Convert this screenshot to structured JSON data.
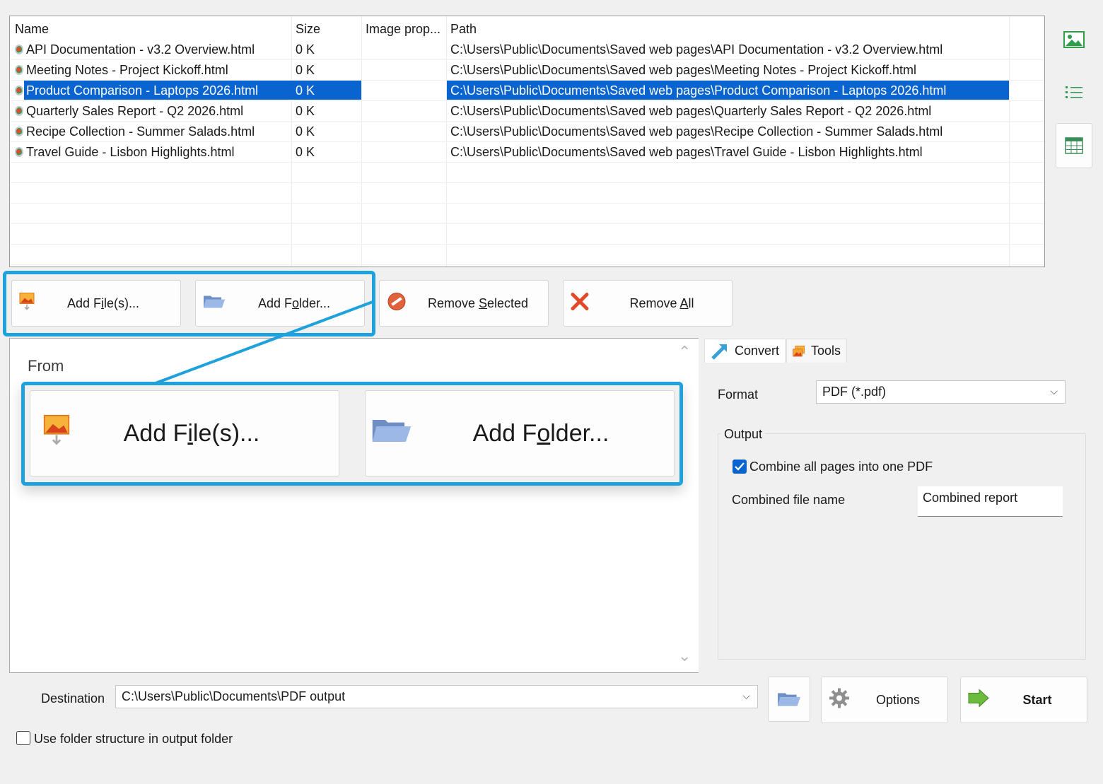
{
  "file_table": {
    "columns": [
      "Name",
      "Size",
      "Image prop...",
      "Path"
    ],
    "rows": [
      {
        "name": "API Documentation - v3.2 Overview.html",
        "size": "0 K",
        "image_props": "",
        "path": "C:\\Users\\Public\\Documents\\Saved web pages\\API Documentation - v3.2 Overview.html",
        "selected": false
      },
      {
        "name": "Meeting Notes - Project Kickoff.html",
        "size": "0 K",
        "image_props": "",
        "path": "C:\\Users\\Public\\Documents\\Saved web pages\\Meeting Notes - Project Kickoff.html",
        "selected": false
      },
      {
        "name": "Product Comparison - Laptops 2026.html",
        "size": "0 K",
        "image_props": "",
        "path": "C:\\Users\\Public\\Documents\\Saved web pages\\Product Comparison - Laptops 2026.html",
        "selected": true
      },
      {
        "name": "Quarterly Sales Report - Q2 2026.html",
        "size": "0 K",
        "image_props": "",
        "path": "C:\\Users\\Public\\Documents\\Saved web pages\\Quarterly Sales Report - Q2 2026.html",
        "selected": false
      },
      {
        "name": "Recipe Collection - Summer Salads.html",
        "size": "0 K",
        "image_props": "",
        "path": "C:\\Users\\Public\\Documents\\Saved web pages\\Recipe Collection - Summer Salads.html",
        "selected": false
      },
      {
        "name": "Travel Guide - Lisbon Highlights.html",
        "size": "0 K",
        "image_props": "",
        "path": "C:\\Users\\Public\\Documents\\Saved web pages\\Travel Guide - Lisbon Highlights.html",
        "selected": false
      }
    ]
  },
  "toolbar": {
    "add_files": {
      "pre": "Add F",
      "mn": "i",
      "post": "le(s)..."
    },
    "add_folder": {
      "pre": "Add F",
      "mn": "o",
      "post": "lder..."
    },
    "remove_selected": {
      "pre": "Remove ",
      "mn": "S",
      "post": "elected"
    },
    "remove_all": {
      "pre": "Remove ",
      "mn": "A",
      "post": "ll"
    }
  },
  "from_pane": {
    "title": "From",
    "zoom_add_files": {
      "pre": "Add F",
      "mn": "i",
      "post": "le(s)..."
    },
    "zoom_add_folder": {
      "pre": "Add F",
      "mn": "o",
      "post": "lder..."
    }
  },
  "tabs": [
    {
      "label": "Convert",
      "icon": "convert-arrow-icon",
      "active": true
    },
    {
      "label": "Tools",
      "icon": "tools-images-icon",
      "active": false
    }
  ],
  "convert": {
    "format_label": "Format",
    "format_value": "PDF (*.pdf)",
    "output_group": "Output",
    "combine_label": "Combine all pages into one PDF",
    "combine_checked": true,
    "combined_name_label": "Combined file name",
    "combined_name_value": "Combined report"
  },
  "bottom": {
    "destination_label": "Destination",
    "destination_value": "C:\\Users\\Public\\Documents\\PDF output",
    "options_label": "Options",
    "start_label": "Start",
    "folder_structure_label": "Use folder structure in output folder",
    "folder_structure_checked": false
  },
  "side_views": [
    "thumbnail-view-icon",
    "list-view-icon",
    "table-view-icon"
  ],
  "colors": {
    "selection": "#0a64cf",
    "callout": "#1fa1db",
    "checkbox": "#0a64cf",
    "window_bg": "#f0f0f0"
  }
}
